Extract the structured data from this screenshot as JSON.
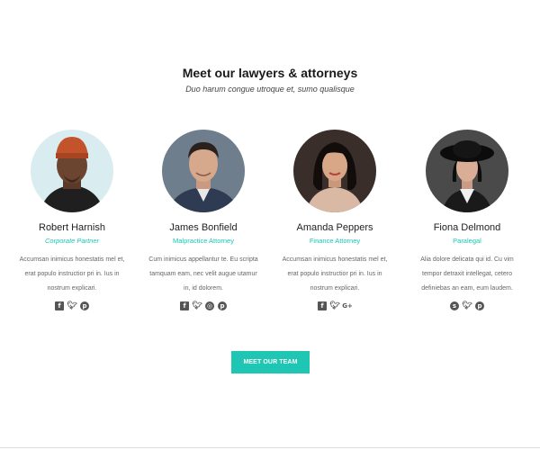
{
  "section": {
    "title": "Meet our lawyers & attorneys",
    "subtitle": "Duo harum congue utroque et, sumo qualisque"
  },
  "members": [
    {
      "name": "Robert Harnish",
      "role": "Corporate Partner",
      "bio": "Accumsan inimicus honestatis mel et, erat populo instructior pri in. Ius in nostrum explicari.",
      "socials": [
        "facebook-icon",
        "twitter-icon",
        "pinterest-icon"
      ]
    },
    {
      "name": "James Bonfield",
      "role": "Malpractice Attorney",
      "bio": "Cum inimicus appellantur te. Eu scripta tamquam eam, nec velit augue utamur in, id dolorem.",
      "socials": [
        "facebook-icon",
        "twitter-icon",
        "instagram-icon",
        "pinterest-icon"
      ]
    },
    {
      "name": "Amanda Peppers",
      "role": "Finance Attorney",
      "bio": "Accumsan inimicus honestatis mel et, erat populo instructior pri in. Ius in nostrum explicari.",
      "socials": [
        "facebook-icon",
        "twitter-icon",
        "google-plus-icon"
      ]
    },
    {
      "name": "Fiona Delmond",
      "role": "Paralegal",
      "bio": "Alia dolore delicata qui id. Cu vim tempor detraxit intellegat, cetero definiebas an eam, eum laudem.",
      "socials": [
        "skype-icon",
        "twitter-icon",
        "pinterest-icon"
      ]
    }
  ],
  "cta": {
    "label": "MEET OUR TEAM"
  },
  "colors": {
    "accent": "#1ec6b3",
    "role_text": "#17c6b5",
    "icon": "#555555"
  }
}
